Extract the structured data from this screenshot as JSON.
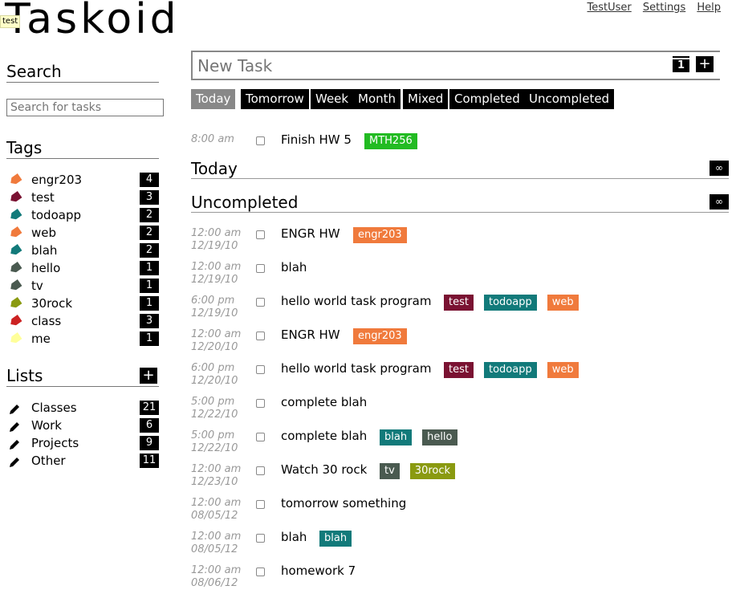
{
  "app": {
    "title": "Taskoid",
    "tooltip": "test"
  },
  "toplinks": [
    "TestUser",
    "Settings",
    "Help"
  ],
  "colors": {
    "engr203": "#f07a3c",
    "test": "#7a1232",
    "todoapp": "#127a7a",
    "web": "#f07a3c",
    "blah": "#127a7a",
    "hello": "#4a5a50",
    "tv": "#4a5a50",
    "30rock": "#8a9a10",
    "class": "#cc2222",
    "me": "#ffff9a",
    "MTH256": "#22bb22",
    "tab_active": "#888888"
  },
  "sidebar": {
    "search_heading": "Search",
    "search_placeholder": "Search for tasks",
    "tags_heading": "Tags",
    "tags": [
      {
        "name": "engr203",
        "count": "4"
      },
      {
        "name": "test",
        "count": "3"
      },
      {
        "name": "todoapp",
        "count": "2"
      },
      {
        "name": "web",
        "count": "2"
      },
      {
        "name": "blah",
        "count": "2"
      },
      {
        "name": "hello",
        "count": "1"
      },
      {
        "name": "tv",
        "count": "1"
      },
      {
        "name": "30rock",
        "count": "1"
      },
      {
        "name": "class",
        "count": "3"
      },
      {
        "name": "me",
        "count": "1"
      }
    ],
    "lists_heading": "Lists",
    "lists_add": "+",
    "lists": [
      {
        "name": "Classes",
        "count": "21"
      },
      {
        "name": "Work",
        "count": "6"
      },
      {
        "name": "Projects",
        "count": "9"
      },
      {
        "name": "Other",
        "count": "11"
      }
    ]
  },
  "main": {
    "newtask_placeholder": "New Task",
    "calendar_num": "1",
    "add_label": "+",
    "tabs": [
      "Today",
      "Tomorrow",
      "Week",
      "Month",
      "Mixed",
      "Completed",
      "Uncompleted"
    ],
    "active_tab": "Today",
    "top_task": {
      "time": "8:00 am",
      "date": "",
      "name": "Finish HW 5",
      "tags": [
        "MTH256"
      ]
    },
    "sections": [
      {
        "title": "Today",
        "toggle": "∞"
      },
      {
        "title": "Uncompleted",
        "toggle": "∞"
      }
    ],
    "tasks": [
      {
        "time": "12:00 am",
        "date": "12/19/10",
        "name": "ENGR HW",
        "tags": [
          "engr203"
        ]
      },
      {
        "time": "12:00 am",
        "date": "12/19/10",
        "name": "blah",
        "tags": []
      },
      {
        "time": "6:00 pm",
        "date": "12/19/10",
        "name": "hello world task program",
        "tags": [
          "test",
          "todoapp",
          "web"
        ]
      },
      {
        "time": "12:00 am",
        "date": "12/20/10",
        "name": "ENGR HW",
        "tags": [
          "engr203"
        ]
      },
      {
        "time": "6:00 pm",
        "date": "12/20/10",
        "name": "hello world task program",
        "tags": [
          "test",
          "todoapp",
          "web"
        ]
      },
      {
        "time": "5:00 pm",
        "date": "12/22/10",
        "name": "complete blah",
        "tags": []
      },
      {
        "time": "5:00 pm",
        "date": "12/22/10",
        "name": "complete blah",
        "tags": [
          "blah",
          "hello"
        ]
      },
      {
        "time": "12:00 am",
        "date": "12/23/10",
        "name": "Watch 30 rock",
        "tags": [
          "tv",
          "30rock"
        ]
      },
      {
        "time": "12:00 am",
        "date": "08/05/12",
        "name": "tomorrow something",
        "tags": []
      },
      {
        "time": "12:00 am",
        "date": "08/05/12",
        "name": "blah",
        "tags": [
          "blah"
        ]
      },
      {
        "time": "12:00 am",
        "date": "08/06/12",
        "name": "homework 7",
        "tags": []
      }
    ]
  }
}
